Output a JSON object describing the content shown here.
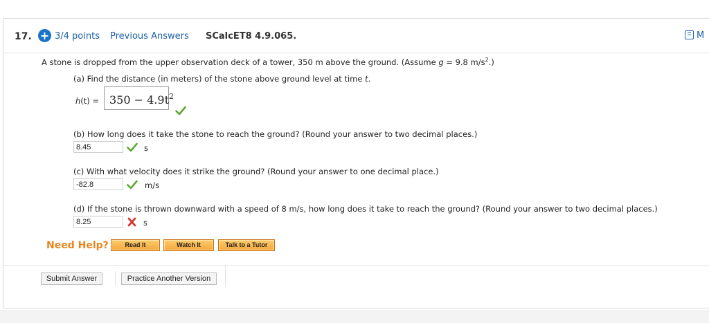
{
  "header": {
    "question_number": "17.",
    "points_icon": "plus-circle-icon",
    "points": "3/4 points",
    "previous_answers": "Previous Answers",
    "problem_id": "SCalcET8 4.9.065.",
    "notes_label": "M"
  },
  "problem": {
    "intro": "A stone is dropped from the upper observation deck of a tower, 350 m above the ground. (Assume ",
    "g_var": "g",
    "g_value": " = 9.8 m/s",
    "g_exp": "2",
    "intro_end": ".)",
    "part_a": {
      "prompt": "(a) Find the distance (in meters) of the stone above ground level at time ",
      "prompt_var": "t",
      "prompt_end": ".",
      "label_fn": "h",
      "label_rest": "(t) =",
      "answer_base": "350 − 4.9t",
      "answer_exp": "2",
      "status": "correct"
    },
    "part_b": {
      "prompt": "(b) How long does it take the stone to reach the ground? (Round your answer to two decimal places.)",
      "answer": "8.45",
      "unit": "s",
      "status": "correct"
    },
    "part_c": {
      "prompt": "(c) With what velocity does it strike the ground? (Round your answer to one decimal place.)",
      "answer": "-82.8",
      "unit": "m/s",
      "status": "correct"
    },
    "part_d": {
      "prompt": "(d) If the stone is thrown downward with a speed of 8 m/s, how long does it take to reach the ground? (Round your answer to two decimal places.)",
      "answer": "8.25",
      "unit": "s",
      "status": "incorrect"
    }
  },
  "help": {
    "label": "Need Help?",
    "read_it": "Read It",
    "watch_it": "Watch It",
    "talk_to_tutor": "Talk to a Tutor"
  },
  "footer": {
    "submit": "Submit Answer",
    "practice": "Practice Another Version"
  },
  "colors": {
    "link": "#1a5fa8",
    "correct": "#5aa832",
    "incorrect": "#d9302c",
    "help_orange": "#e8841d"
  }
}
